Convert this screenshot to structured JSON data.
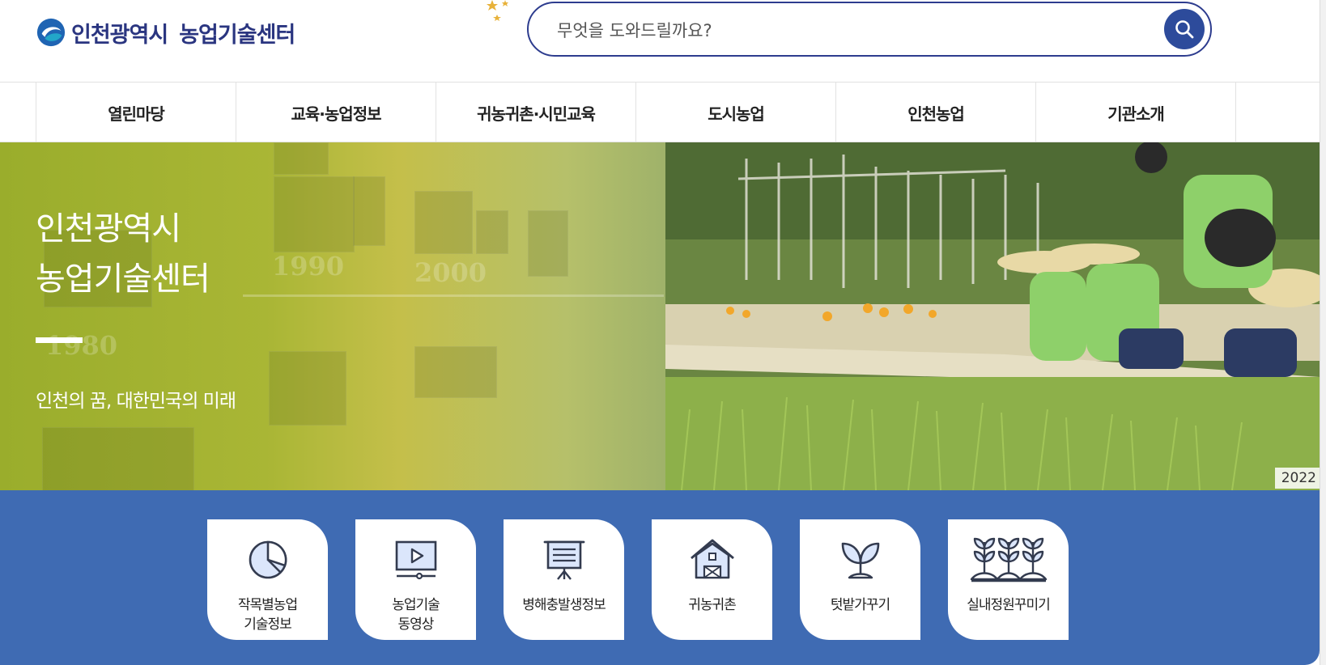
{
  "header": {
    "logo_city": "인천광역시",
    "logo_org": "농업기술센터",
    "search_placeholder": "무엇을 도와드릴까요?"
  },
  "gnb": {
    "items": [
      "열린마당",
      "교육·농업정보",
      "귀농귀촌·시민교육",
      "도시농업",
      "인천농업",
      "기관소개"
    ]
  },
  "hero": {
    "title": "인천광역시\n농업기술센터",
    "subtitle": "인천의 꿈, 대한민국의 미래",
    "years": [
      "1990",
      "2000",
      "1980"
    ],
    "badge": "2022"
  },
  "quick_menu": {
    "items": [
      {
        "label": "작목별농업\n기술정보",
        "icon": "pie-chart-icon"
      },
      {
        "label": "농업기술\n동영상",
        "icon": "video-play-icon"
      },
      {
        "label": "병해충발생정보",
        "icon": "presentation-board-icon"
      },
      {
        "label": "귀농귀촌",
        "icon": "farmhouse-icon"
      },
      {
        "label": "텃밭가꾸기",
        "icon": "sprout-icon"
      },
      {
        "label": "실내정원꾸미기",
        "icon": "plants-row-icon"
      }
    ]
  },
  "colors": {
    "brand_navy": "#2a3580",
    "search_border": "#2d3c8e",
    "search_button": "#2d4b9b",
    "quick_bg": "#3f6bb3",
    "hero_green": "#a9b635"
  }
}
